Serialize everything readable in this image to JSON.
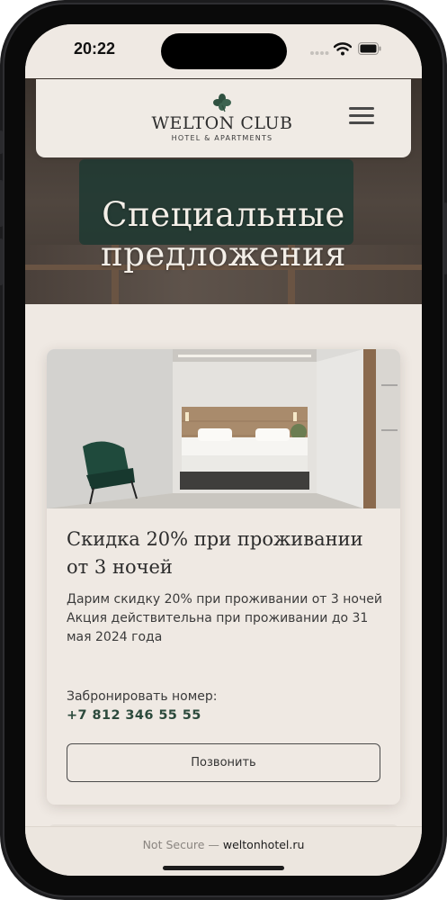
{
  "status_bar": {
    "time": "20:22"
  },
  "header": {
    "logo_name": "WELTON CLUB",
    "logo_sub": "HOTEL & APARTMENTS"
  },
  "hero": {
    "title_line1": "Специальные",
    "title_line2": "предложения"
  },
  "offer": {
    "title": "Скидка 20% при проживании от 3 ночей",
    "description_line1": "Дарим скидку 20% при проживании от 3 ночей",
    "description_line2": "Акция действительна при проживании до 31 мая 2024 года",
    "book_label": "Забронировать номер:",
    "phone": "+7 812 346 55 55",
    "call_button": "Позвонить"
  },
  "browser": {
    "security": "Not Secure —",
    "host": "weltonhotel.ru"
  },
  "colors": {
    "background": "#efe9e3",
    "accent_green": "#2c4a3c",
    "text_dark": "#2c2c2c"
  },
  "icons": [
    "clover-logo-icon",
    "hamburger-menu-icon",
    "signal-icon",
    "wifi-icon",
    "battery-icon"
  ]
}
